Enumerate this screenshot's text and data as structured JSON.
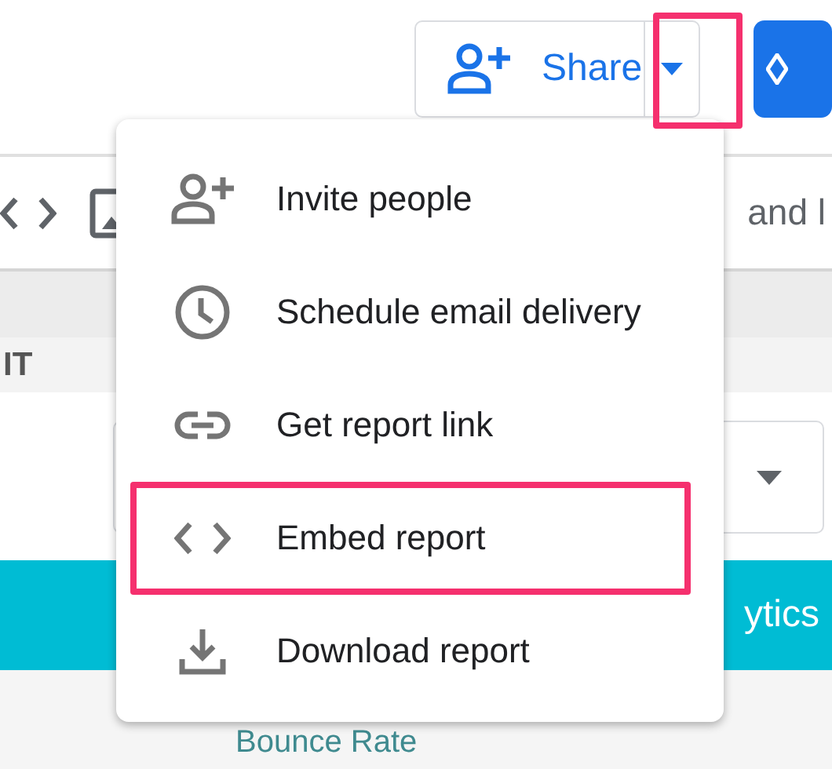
{
  "header": {
    "share_button": {
      "label": "Share"
    },
    "share_menu_button": {
      "highlighted": true
    }
  },
  "toolbar": {
    "text": "and l"
  },
  "section": {
    "label": "IT"
  },
  "banner": {
    "text": "ytics"
  },
  "scorecard": {
    "label": "Bounce Rate"
  },
  "share_menu": {
    "items": [
      {
        "kind": "invite",
        "label": "Invite people",
        "highlighted": false
      },
      {
        "kind": "schedule",
        "label": "Schedule email delivery",
        "highlighted": false
      },
      {
        "kind": "link",
        "label": "Get report link",
        "highlighted": false
      },
      {
        "kind": "embed",
        "label": "Embed report",
        "highlighted": true
      },
      {
        "kind": "download",
        "label": "Download report",
        "highlighted": false
      }
    ]
  }
}
